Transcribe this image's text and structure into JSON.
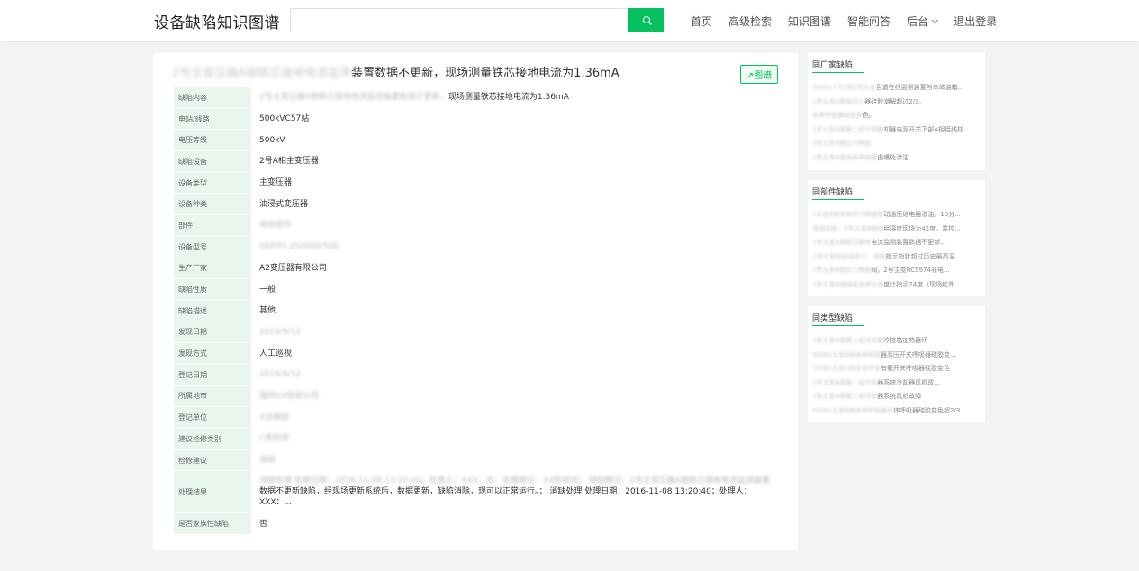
{
  "header": {
    "logo": "设备缺陷知识图谱",
    "search_placeholder": "",
    "nav": [
      "首页",
      "高级检索",
      "知识图谱",
      "智能问答",
      "后台",
      "退出登录"
    ]
  },
  "main": {
    "title_blur": "2号主变压器A相铁芯接地电流监测",
    "title_clear": "装置数据不更新，现场测量铁芯接地电流为1.36mA",
    "graph_button": "↗图谱",
    "rows": [
      {
        "label": "缺陷内容",
        "value_blur": "2号主变压器A相铁芯接地电流监测装置数据不更新，",
        "value": "现场测量铁芯接地电流为1.36mA"
      },
      {
        "label": "电站/线路",
        "value_blur": "",
        "value": "500kVC57站"
      },
      {
        "label": "电压等级",
        "value_blur": "",
        "value": "500kV"
      },
      {
        "label": "缺陷设备",
        "value_blur": "",
        "value": "2号A相主变压器"
      },
      {
        "label": "设备类型",
        "value_blur": "",
        "value": "主变压器"
      },
      {
        "label": "设备种类",
        "value_blur": "",
        "value": "油浸式变压器"
      },
      {
        "label": "部件",
        "value_blur": "其他部件",
        "value": ""
      },
      {
        "label": "设备型号",
        "value_blur": "ODFPS-250000/500",
        "value": ""
      },
      {
        "label": "生产厂家",
        "value_blur": "",
        "value": "A2变压器有限公司"
      },
      {
        "label": "缺陷性质",
        "value_blur": "",
        "value": "一般"
      },
      {
        "label": "缺陷描述",
        "value_blur": "",
        "value": "其他"
      },
      {
        "label": "发现日期",
        "value_blur": "2016/9/12",
        "value": ""
      },
      {
        "label": "发现方式",
        "value_blur": "",
        "value": "人工巡视"
      },
      {
        "label": "登记日期",
        "value_blur": "2016/9/12",
        "value": ""
      },
      {
        "label": "所属地市",
        "value_blur": "国网XX检修公司",
        "value": ""
      },
      {
        "label": "登记单位",
        "value_blur": "X运维班",
        "value": ""
      },
      {
        "label": "建议检修类别",
        "value_blur": "C类检修",
        "value": ""
      },
      {
        "label": "检修建议",
        "value_blur": "消缺",
        "value": ""
      },
      {
        "label": "处理结果",
        "value_blur": "消缺处理 处理日期：2016-11-08 13:20:00；处理人：XXX；无；处理单位：XX检修班；  缺陷概况：2号主变压器A相铁芯接地电流监测装置",
        "value": "数据不更新缺陷，经现场更新系统后，数据更新，缺陷消除，现可以正常运行。；  消缺处理  处理日期：2016-11-08 13:20:40；处理人：XXX：..."
      },
      {
        "label": "是否家族性缺陷",
        "value_blur": "",
        "value": "否"
      }
    ]
  },
  "sidebar": [
    {
      "title": "同厂家缺陷",
      "items": [
        {
          "blur": "500kV C57站2号主变",
          "clear": "色谱在线监测装置与本体油箱..."
        },
        {
          "blur": "2号主变A相油位计",
          "clear": "器硅胶潮解超过2/3。"
        },
        {
          "blur": "本体呼吸器硅胶变",
          "clear": "色。"
        },
        {
          "blur": "2号主变A相第二组冷却器",
          "clear": "却器电源开关下部A相接线柱..."
        },
        {
          "blur": "2号主变A相压力释放",
          "clear": ""
        },
        {
          "blur": "1号主变A相本体呼吸器",
          "clear": "由嘴处渗油"
        }
      ]
    },
    {
      "title": "同部件缺陷",
      "items": [
        {
          "blur": "1主变B相本体压力释放阀",
          "clear": "动油压继电器渗油，10分..."
        },
        {
          "blur": "现场实际，2号主变B相绕",
          "clear": "组温度现场为42度，监控..."
        },
        {
          "blur": "2号主变A相铁芯接地",
          "clear": "电流监测装置数据不更新..."
        },
        {
          "blur": "2号主变绕组温度计，温度",
          "clear": "指示指针超过历史最高温..."
        },
        {
          "blur": "2号主变B相压力释放",
          "clear": "阀，2号主变RCS974非电..."
        },
        {
          "blur": "1号主变A相绕组温度计温",
          "clear": "度计指示24度（现场红外..."
        }
      ]
    },
    {
      "title": "同类型缺陷",
      "items": [
        {
          "blur": "1号主变A相第三组冷却器",
          "clear": "冷控箱加热器坏"
        },
        {
          "blur": "500kV主变B相本体呼吸",
          "clear": "器高压开关呼吸器硅胶变..."
        },
        {
          "blur": "500kV主变A相本体呼吸",
          "clear": "有载开关呼吸器硅胶变色"
        },
        {
          "blur": "2号主变B相第一组冷却",
          "clear": "器系统冷却器风机故..."
        },
        {
          "blur": "1号主变A相第三组冷却",
          "clear": "器系统风机故障"
        },
        {
          "blur": "500kV主变B相本体呼吸器本",
          "clear": "体呼吸器硅胶变色超2/3"
        }
      ]
    }
  ]
}
